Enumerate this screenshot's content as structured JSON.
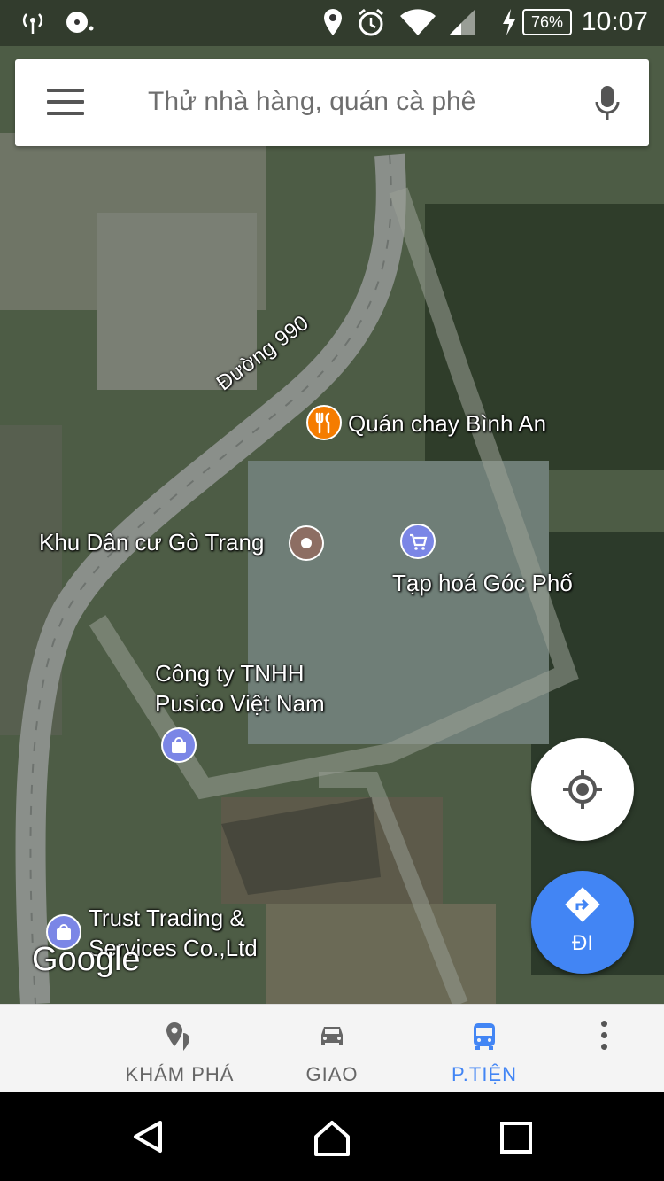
{
  "status_bar": {
    "battery": "76%",
    "time": "10:07"
  },
  "search": {
    "placeholder": "Thử nhà hàng, quán cà phê"
  },
  "map_labels": {
    "road": "Đường 990",
    "poi_restaurant": "Quán chay Bình An",
    "poi_residential": "Khu Dân cư Gò Trang",
    "poi_grocery": "Tạp hoá Góc Phố",
    "poi_company_line1": "Công ty TNHH",
    "poi_company_line2": "Pusico Việt Nam",
    "poi_trust_line1": "Trust Trading &",
    "poi_trust_line2": "Services Co.,Ltd",
    "google_logo": "Google"
  },
  "buttons": {
    "go_label": "ĐI"
  },
  "bottom_nav": {
    "tabs": [
      {
        "label": "KHÁM PHÁ",
        "icon": "explore-pin-icon"
      },
      {
        "label": "GIAO",
        "icon": "car-icon"
      },
      {
        "label": "P.TIỆN",
        "icon": "bus-icon"
      }
    ]
  },
  "colors": {
    "accent": "#4285f4",
    "restaurant_pin": "#f57c00",
    "shop_pin": "#7b86e6",
    "place_pin": "#8d6e63"
  }
}
